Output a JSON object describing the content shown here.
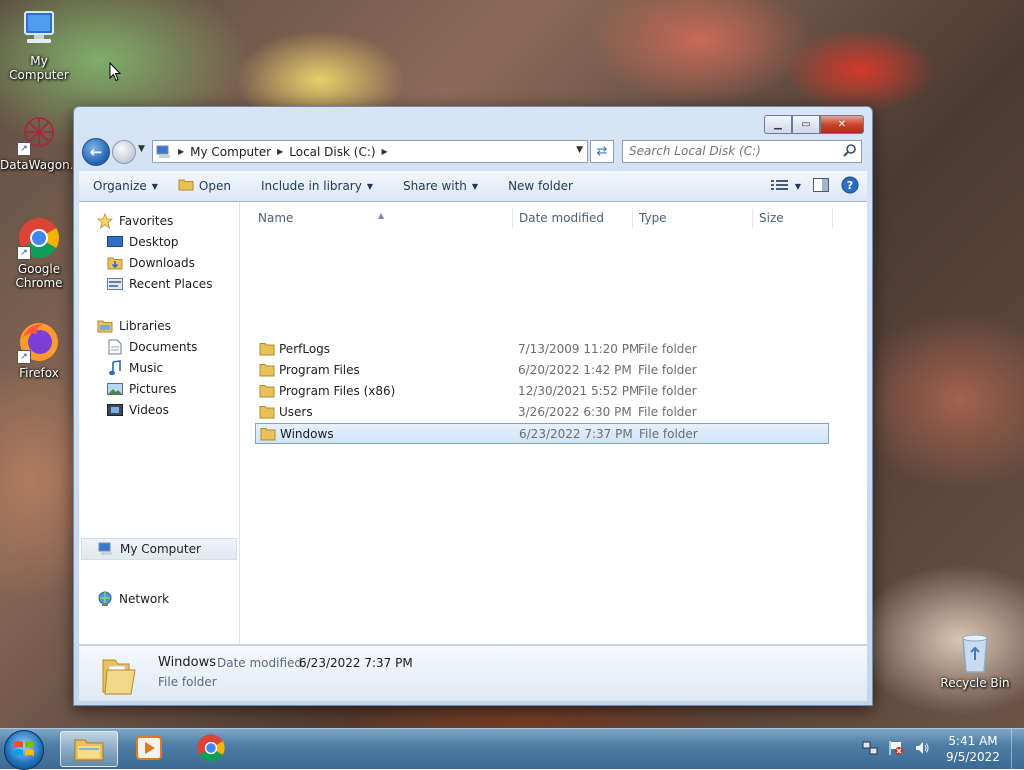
{
  "colors": {
    "accent": "#1e5fb3",
    "selection_border": "#7da2ce",
    "window_frame": "#c4d6ee"
  },
  "desktop": {
    "icons": [
      {
        "label": "My Computer",
        "icon": "computer-icon"
      },
      {
        "label": "DataWagon...",
        "icon": "datawagon-icon"
      },
      {
        "label": "Google Chrome",
        "icon": "chrome-icon"
      },
      {
        "label": "Firefox",
        "icon": "firefox-icon"
      },
      {
        "label": "Recycle Bin",
        "icon": "recycle-bin-icon"
      }
    ]
  },
  "window": {
    "address": {
      "segments": [
        "My Computer",
        "Local Disk (C:)"
      ]
    },
    "search": {
      "placeholder": "Search Local Disk (C:)"
    },
    "toolbar": {
      "organize": "Organize",
      "open": "Open",
      "include_in_library": "Include in library",
      "share_with": "Share with",
      "new_folder": "New folder"
    },
    "nav": {
      "favorites": "Favorites",
      "desktop": "Desktop",
      "downloads": "Downloads",
      "recent_places": "Recent Places",
      "libraries": "Libraries",
      "documents": "Documents",
      "music": "Music",
      "pictures": "Pictures",
      "videos": "Videos",
      "my_computer": "My Computer",
      "network": "Network"
    },
    "columns": {
      "name": "Name",
      "date": "Date modified",
      "type": "Type",
      "size": "Size"
    },
    "files": [
      {
        "name": "PerfLogs",
        "date": "7/13/2009 11:20 PM",
        "type": "File folder"
      },
      {
        "name": "Program Files",
        "date": "6/20/2022 1:42 PM",
        "type": "File folder"
      },
      {
        "name": "Program Files (x86)",
        "date": "12/30/2021 5:52 PM",
        "type": "File folder"
      },
      {
        "name": "Users",
        "date": "3/26/2022 6:30 PM",
        "type": "File folder"
      },
      {
        "name": "Windows",
        "date": "6/23/2022 7:37 PM",
        "type": "File folder"
      }
    ],
    "details": {
      "name": "Windows",
      "date_label": "Date modified:",
      "date_value": "6/23/2022 7:37 PM",
      "type": "File folder"
    }
  },
  "taskbar": {
    "apps": [
      "explorer-icon",
      "media-player-icon",
      "chrome-icon"
    ],
    "clock": {
      "time": "5:41 AM",
      "date": "9/5/2022"
    }
  }
}
